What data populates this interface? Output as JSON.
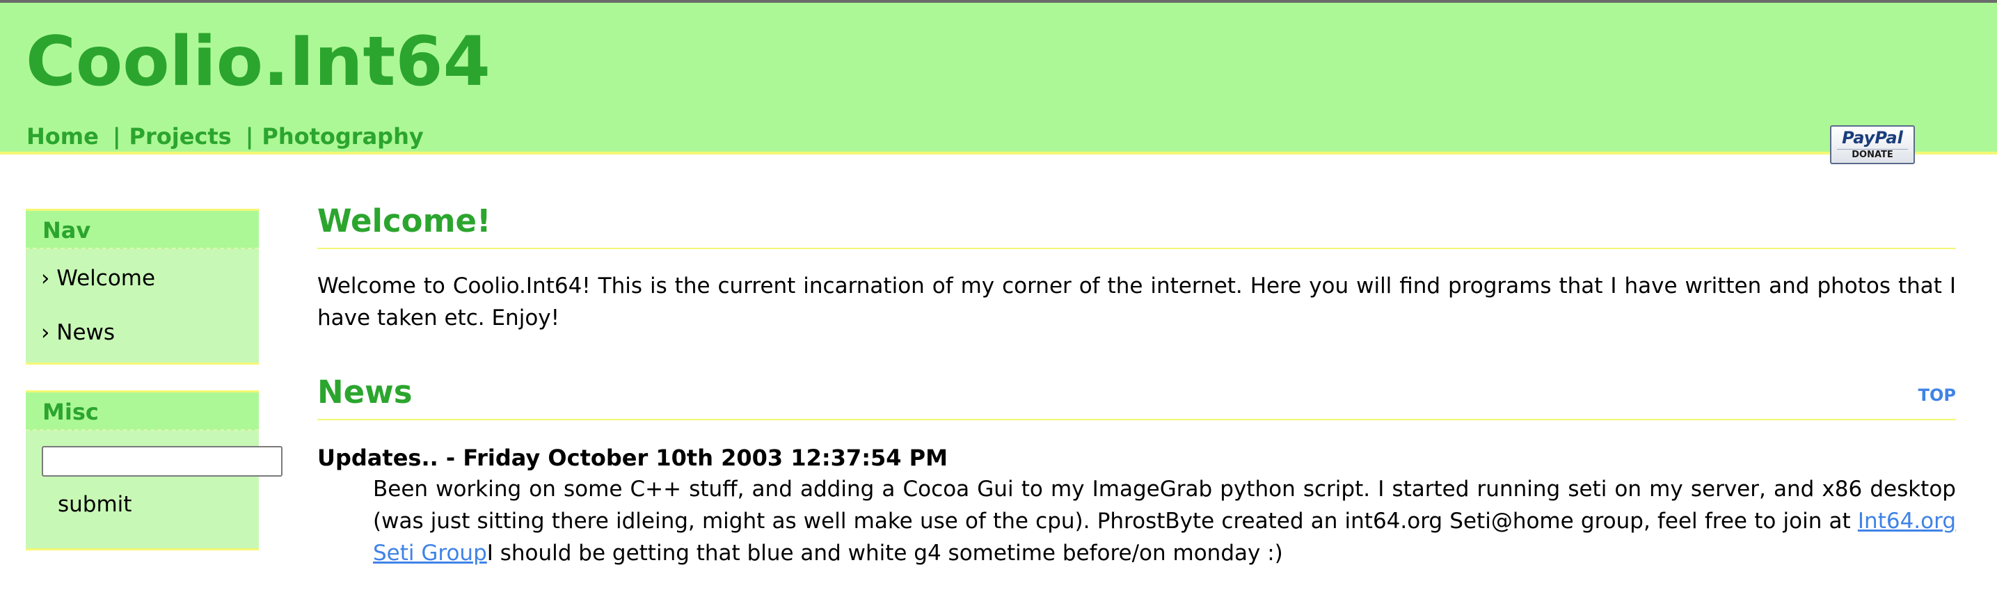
{
  "header": {
    "site_title": "Coolio.Int64",
    "nav": [
      {
        "label": "Home"
      },
      {
        "label": "Projects"
      },
      {
        "label": "Photography"
      }
    ],
    "separator": "|",
    "paypal": {
      "logo_text": "PayPal",
      "donate_text": "DONATE"
    }
  },
  "sidebar": {
    "nav_box": {
      "title": "Nav",
      "items": [
        {
          "label": "› Welcome"
        },
        {
          "label": "› News"
        }
      ]
    },
    "misc_box": {
      "title": "Misc",
      "search_value": "",
      "submit_label": "submit"
    }
  },
  "main": {
    "welcome": {
      "heading": "Welcome!",
      "text": "Welcome to Coolio.Int64! This is the current incarnation of my corner of the internet. Here you will find programs that I have written and photos that I have taken etc. Enjoy!"
    },
    "news": {
      "heading": "News",
      "top_link": "TOP",
      "post_title": "Updates.. - Friday October 10th 2003 12:37:54 PM",
      "body_before_link": "Been working on some C++ stuff, and adding a Cocoa Gui to my ImageGrab python script. I started running seti on my server, and x86 desktop (was just sitting there idleing, might as well make use of the cpu). PhrostByte created an int64.org Seti@home group, feel free to join at ",
      "link_text": "Int64.org Seti Group",
      "body_after_link": "I should be getting that blue and white g4 sometime before/on monday :)"
    }
  },
  "colors": {
    "header_bg": "#adf896",
    "accent_green": "#2ba52e",
    "box_bg": "#c8f8b6",
    "rule_yellow": "#f4f774",
    "link_blue": "#3f83e6"
  }
}
